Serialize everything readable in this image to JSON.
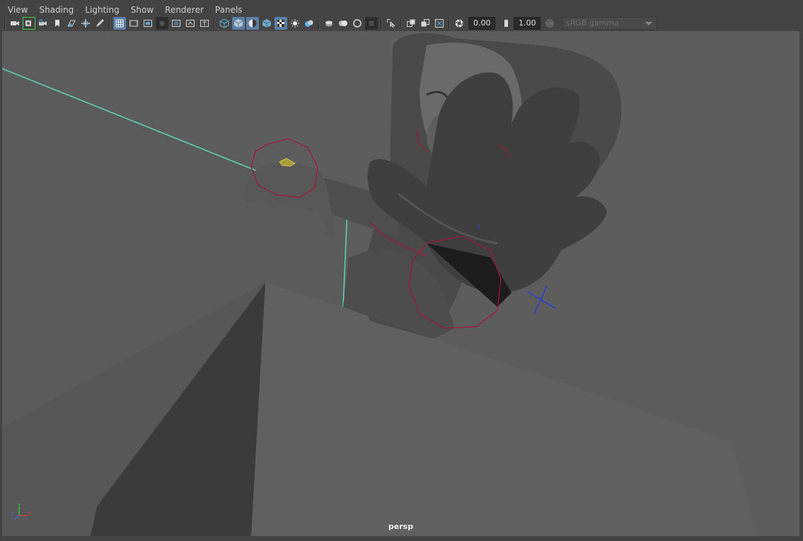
{
  "menu": {
    "items": [
      "View",
      "Shading",
      "Lighting",
      "Show",
      "Renderer",
      "Panels"
    ]
  },
  "toolbar": {
    "exposure_value": "0.00",
    "gamma_value": "1.00",
    "color_space": "sRGB gamma"
  },
  "viewport": {
    "camera_label": "persp"
  },
  "colors": {
    "ui_background": "#444444",
    "viewport_background": "#5d5d5d",
    "active_button": "#5b7fa6",
    "selection_highlight": "#5ad6b8",
    "nurbs_curve": "#a8143c",
    "locator": "#2a3cdc"
  },
  "icons": [
    "camera-select-icon",
    "camera-attributes-icon",
    "bookmark-icon",
    "image-plane-icon",
    "2d-pan-zoom-icon",
    "grease-pencil-icon",
    "grid-icon",
    "film-gate-icon",
    "resolution-gate-icon",
    "gate-mask-icon",
    "field-chart-icon",
    "safe-action-icon",
    "safe-title-icon",
    "wireframe-icon",
    "smooth-shade-icon",
    "wireframe-on-shaded-icon",
    "textured-icon",
    "default-lighting-icon",
    "shadows-icon",
    "ambient-occlusion-icon",
    "motion-blur-icon",
    "anti-aliasing-icon",
    "depth-of-field-icon",
    "isolate-select-icon",
    "xray-icon",
    "xray-joints-icon",
    "xray-active-components-icon",
    "exposure-icon",
    "gamma-icon",
    "color-management-icon"
  ]
}
